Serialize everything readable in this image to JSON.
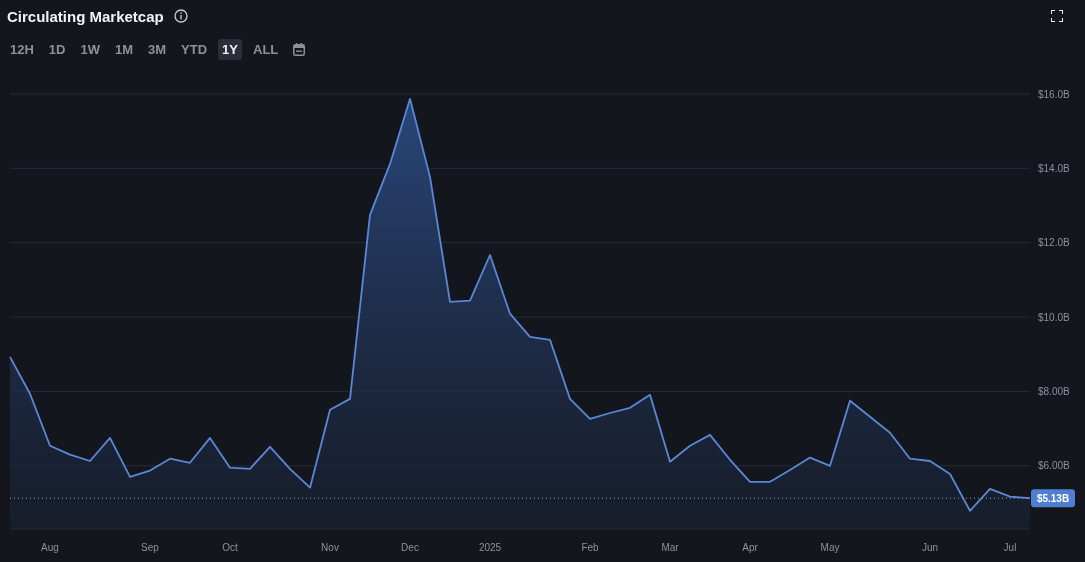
{
  "title": "Circulating Marketcap",
  "timeframes": [
    {
      "label": "12H",
      "selected": false
    },
    {
      "label": "1D",
      "selected": false
    },
    {
      "label": "1W",
      "selected": false
    },
    {
      "label": "1M",
      "selected": false
    },
    {
      "label": "3M",
      "selected": false
    },
    {
      "label": "YTD",
      "selected": false
    },
    {
      "label": "1Y",
      "selected": true
    },
    {
      "label": "ALL",
      "selected": false
    }
  ],
  "chart": {
    "chart_data": {
      "type": "area",
      "categories": [
        null,
        null,
        "Aug",
        null,
        null,
        null,
        null,
        "Sep",
        null,
        null,
        null,
        "Oct",
        null,
        null,
        null,
        null,
        "Nov",
        null,
        null,
        null,
        "Dec",
        null,
        null,
        null,
        "2025",
        null,
        null,
        null,
        null,
        "Feb",
        null,
        null,
        null,
        "Mar",
        null,
        null,
        null,
        "Apr",
        null,
        null,
        null,
        "May",
        null,
        null,
        null,
        null,
        "Jun",
        null,
        null,
        null,
        "Jul",
        null
      ],
      "series": [
        {
          "color": "#5b87d6",
          "values": [
            8.93,
            7.94,
            6.54,
            6.3,
            6.13,
            6.75,
            5.7,
            5.87,
            6.19,
            6.08,
            6.75,
            5.95,
            5.92,
            6.51,
            5.92,
            5.41,
            7.51,
            7.8,
            12.75,
            14.12,
            15.87,
            13.77,
            10.41,
            10.44,
            11.67,
            10.09,
            9.47,
            9.39,
            7.8,
            7.26,
            7.42,
            7.56,
            7.91,
            6.11,
            6.54,
            6.83,
            6.16,
            5.57,
            5.57,
            5.89,
            6.22,
            6.0,
            7.75,
            7.32,
            6.89,
            6.19,
            6.13,
            5.78,
            4.79,
            5.38,
            5.17,
            5.13
          ]
        }
      ],
      "grid": true,
      "ylim": [
        4.3,
        16
      ],
      "yticks": [
        {
          "value": 6,
          "label": "$6.00B"
        },
        {
          "value": 8,
          "label": "$8.00B"
        },
        {
          "value": 10,
          "label": "$10.0B"
        },
        {
          "value": 12,
          "label": "$12.0B"
        },
        {
          "value": 14,
          "label": "$14.0B"
        },
        {
          "value": 16,
          "label": "$16.0B"
        }
      ],
      "ref_lines": [
        {
          "axis": "y",
          "value": 5.13,
          "label": "$5.13B"
        }
      ]
    }
  }
}
